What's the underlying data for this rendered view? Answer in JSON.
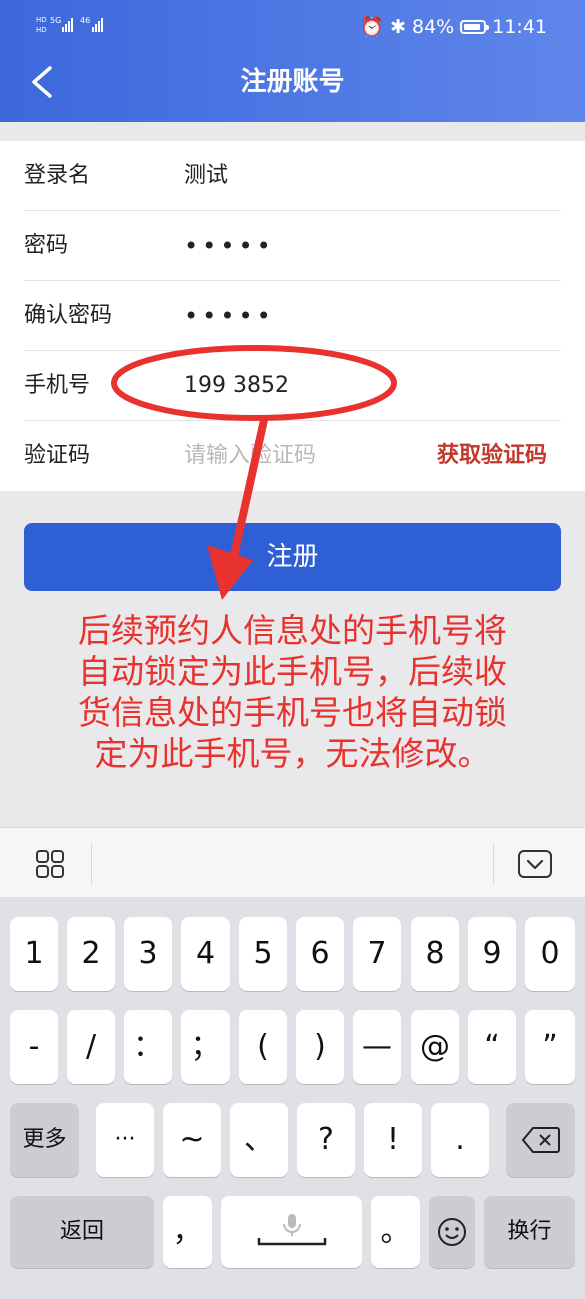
{
  "status_bar": {
    "signal_text": "HD 5G 46",
    "battery": "84%",
    "time": "11:41"
  },
  "header": {
    "title": "注册账号"
  },
  "form": {
    "fields": [
      {
        "label": "登录名",
        "value": "测试"
      },
      {
        "label": "密码",
        "value": "•••••"
      },
      {
        "label": "确认密码",
        "value": "•••••"
      },
      {
        "label": "手机号",
        "value": "199 3852"
      },
      {
        "label": "验证码",
        "placeholder": "请输入验证码"
      }
    ],
    "get_code_label": "获取验证码"
  },
  "submit_label": "注册",
  "annotation": {
    "lines": [
      "后续预约人信息处的手机号将",
      "自动锁定为此手机号，后续收",
      "货信息处的手机号也将自动锁",
      "定为此手机号，无法修改。"
    ],
    "color": "#e8322e"
  },
  "keyboard": {
    "row1": [
      "1",
      "2",
      "3",
      "4",
      "5",
      "6",
      "7",
      "8",
      "9",
      "0"
    ],
    "row2": [
      "-",
      "/",
      "：",
      "；",
      "(",
      ")",
      "—",
      "@",
      "“",
      "”"
    ],
    "row3": [
      "更多",
      "···",
      "~",
      "、",
      "?",
      "!",
      "."
    ],
    "row4": [
      "返回",
      "，",
      "。",
      "换行"
    ]
  },
  "colors": {
    "header": "#3c68dc",
    "submit": "#2e5fd4",
    "get_code": "#c0392b"
  }
}
